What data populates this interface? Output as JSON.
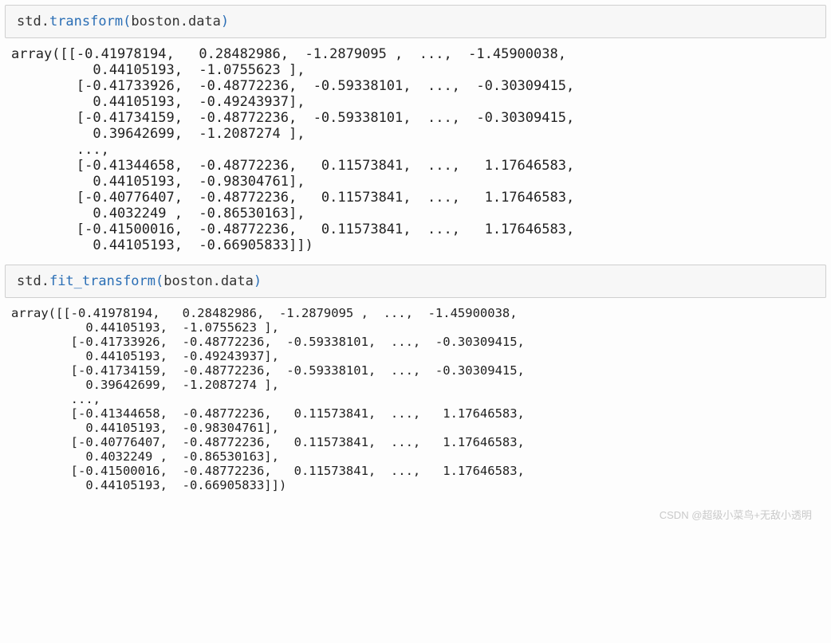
{
  "cell1": {
    "input_prefix": "std.",
    "input_fn": "transform",
    "input_arg": "boston.data",
    "output": "array([[-0.41978194,   0.28482986,  -1.2879095 ,  ...,  -1.45900038,\n          0.44105193,  -1.0755623 ],\n        [-0.41733926,  -0.48772236,  -0.59338101,  ...,  -0.30309415,\n          0.44105193,  -0.49243937],\n        [-0.41734159,  -0.48772236,  -0.59338101,  ...,  -0.30309415,\n          0.39642699,  -1.2087274 ],\n        ...,\n        [-0.41344658,  -0.48772236,   0.11573841,  ...,   1.17646583,\n          0.44105193,  -0.98304761],\n        [-0.40776407,  -0.48772236,   0.11573841,  ...,   1.17646583,\n          0.4032249 ,  -0.86530163],\n        [-0.41500016,  -0.48772236,   0.11573841,  ...,   1.17646583,\n          0.44105193,  -0.66905833]])"
  },
  "cell2": {
    "input_prefix": "std.",
    "input_fn": "fit_transform",
    "input_arg": "boston.data",
    "output": "array([[-0.41978194,   0.28482986,  -1.2879095 ,  ...,  -1.45900038,\n          0.44105193,  -1.0755623 ],\n        [-0.41733926,  -0.48772236,  -0.59338101,  ...,  -0.30309415,\n          0.44105193,  -0.49243937],\n        [-0.41734159,  -0.48772236,  -0.59338101,  ...,  -0.30309415,\n          0.39642699,  -1.2087274 ],\n        ...,\n        [-0.41344658,  -0.48772236,   0.11573841,  ...,   1.17646583,\n          0.44105193,  -0.98304761],\n        [-0.40776407,  -0.48772236,   0.11573841,  ...,   1.17646583,\n          0.4032249 ,  -0.86530163],\n        [-0.41500016,  -0.48772236,   0.11573841,  ...,   1.17646583,\n          0.44105193,  -0.66905833]])"
  },
  "watermark": "CSDN @超级小菜鸟+无敌小透明"
}
